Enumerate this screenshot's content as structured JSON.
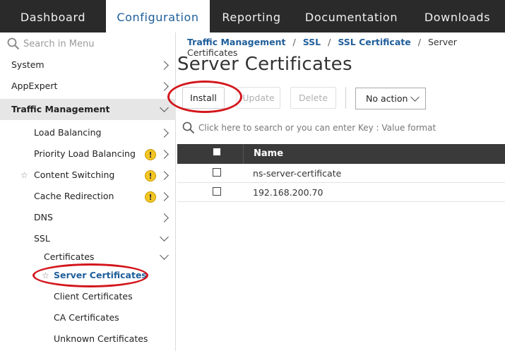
{
  "nav": {
    "tabs": [
      {
        "label": "Dashboard"
      },
      {
        "label": "Configuration"
      },
      {
        "label": "Reporting"
      },
      {
        "label": "Documentation"
      },
      {
        "label": "Downloads"
      }
    ],
    "active": "Configuration"
  },
  "sidebar": {
    "search_placeholder": "Search in Menu",
    "items": [
      {
        "label": "System"
      },
      {
        "label": "AppExpert"
      },
      {
        "label": "Traffic Management"
      },
      {
        "label": "Load Balancing"
      },
      {
        "label": "Priority Load Balancing"
      },
      {
        "label": "Content Switching"
      },
      {
        "label": "Cache Redirection"
      },
      {
        "label": "DNS"
      },
      {
        "label": "SSL"
      },
      {
        "label": "Certificates"
      },
      {
        "label": "Server Certificates"
      },
      {
        "label": "Client Certificates"
      },
      {
        "label": "CA Certificates"
      },
      {
        "label": "Unknown Certificates"
      }
    ],
    "warning_glyph": "!",
    "star_glyph": "☆"
  },
  "breadcrumb": {
    "items": [
      "Traffic Management",
      "SSL",
      "SSL Certificate",
      "Server Certificates"
    ],
    "separator": "/"
  },
  "page": {
    "title": "Server Certificates"
  },
  "toolbar": {
    "install": "Install",
    "update": "Update",
    "delete": "Delete",
    "action_select": "No action"
  },
  "table_search": {
    "placeholder": "Click here to search or you can enter Key : Value format"
  },
  "table": {
    "header": "Name",
    "rows": [
      {
        "name": "ns-server-certificate"
      },
      {
        "name": "192.168.200.70"
      }
    ]
  },
  "colors": {
    "nav_bg": "#2a2a2a",
    "accent": "#1f5e9a",
    "annotation": "#d3161c",
    "warning": "#f3c623"
  }
}
